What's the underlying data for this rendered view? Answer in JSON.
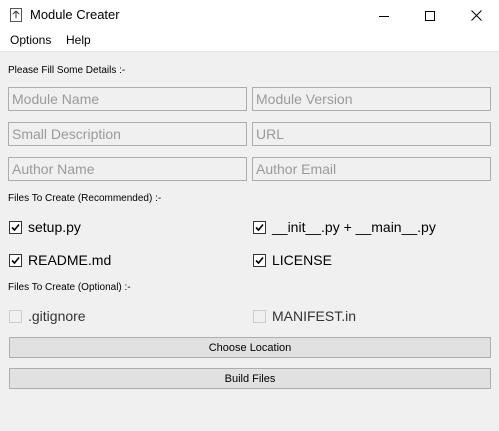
{
  "window": {
    "title": "Module Creater",
    "icon": "app-upload-icon",
    "controls": [
      "minimize-icon",
      "maximize-icon",
      "close-icon"
    ]
  },
  "menu": {
    "options": "Options",
    "help": "Help"
  },
  "details": {
    "heading": "Please Fill Some Details :-",
    "module_name": {
      "value": "",
      "placeholder": "Module Name"
    },
    "module_version": {
      "value": "",
      "placeholder": "Module Version"
    },
    "small_description": {
      "value": "",
      "placeholder": "Small Description"
    },
    "url": {
      "value": "",
      "placeholder": "URL"
    },
    "author_name": {
      "value": "",
      "placeholder": "Author Name"
    },
    "author_email": {
      "value": "",
      "placeholder": "Author Email"
    }
  },
  "recommended": {
    "heading": "Files To Create (Recommended) :-",
    "items": [
      {
        "label": "setup.py",
        "checked": true
      },
      {
        "label": "__init__.py + __main__.py",
        "checked": true
      },
      {
        "label": "README.md",
        "checked": true
      },
      {
        "label": "LICENSE",
        "checked": true
      }
    ]
  },
  "optional": {
    "heading": "Files To Create (Optional) :-",
    "items": [
      {
        "label": ".gitignore",
        "checked": false
      },
      {
        "label": "MANIFEST.in",
        "checked": false
      }
    ]
  },
  "buttons": {
    "choose_location": "Choose Location",
    "build_files": "Build Files"
  }
}
